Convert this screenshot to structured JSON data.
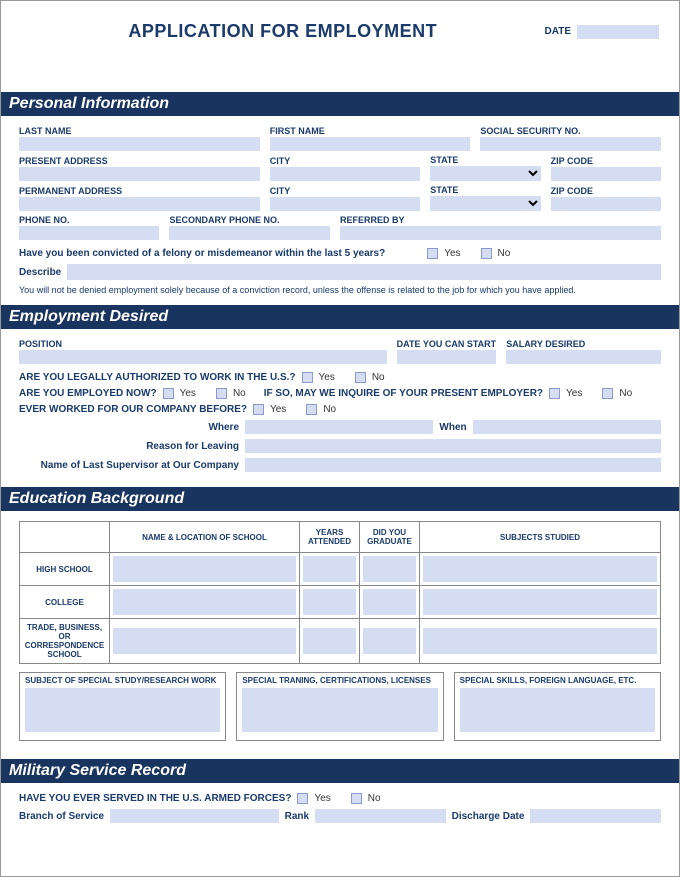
{
  "header": {
    "title": "APPLICATION FOR EMPLOYMENT",
    "date_label": "DATE"
  },
  "personal": {
    "section": "Personal Information",
    "last_name": "LAST NAME",
    "first_name": "FIRST NAME",
    "ssn": "SOCIAL SECURITY NO.",
    "present_address": "PRESENT ADDRESS",
    "city": "CITY",
    "state": "STATE",
    "zip": "ZIP CODE",
    "permanent_address": "PERMANENT ADDRESS",
    "phone": "PHONE NO.",
    "secondary_phone": "SECONDARY PHONE NO.",
    "referred_by": "REFERRED BY",
    "felony_q": "Have you been convicted of a felony or misdemeanor within the last 5 years?",
    "yes": "Yes",
    "no": "No",
    "describe": "Describe",
    "disclaimer": "You will not be denied employment solely because of a conviction record, unless the offense is related to the job for which you have applied."
  },
  "employment": {
    "section": "Employment Desired",
    "position": "POSITION",
    "date_start": "DATE YOU CAN START",
    "salary": "SALARY DESIRED",
    "authorized": "ARE YOU LEGALLY AUTHORIZED TO WORK IN THE U.S.?",
    "employed_now": "ARE YOU EMPLOYED NOW?",
    "inquire": "IF SO, MAY WE INQUIRE OF YOUR PRESENT EMPLOYER?",
    "ever_worked": "EVER WORKED FOR OUR COMPANY BEFORE?",
    "where": "Where",
    "when": "When",
    "reason_leaving": "Reason for Leaving",
    "last_supervisor": "Name of Last Supervisor at Our Company",
    "yes": "Yes",
    "no": "No"
  },
  "education": {
    "section": "Education Background",
    "col_school": "NAME & LOCATION OF SCHOOL",
    "col_years": "YEARS ATTENDED",
    "col_graduate": "DID YOU GRADUATE",
    "col_subjects": "SUBJECTS STUDIED",
    "row_highschool": "HIGH SCHOOL",
    "row_college": "COLLEGE",
    "row_trade": "TRADE, BUSINESS, OR CORRESPONDENCE SCHOOL",
    "special_study": "SUBJECT OF SPECIAL STUDY/RESEARCH WORK",
    "special_training": "SPECIAL TRANING, CERTIFICATIONS, LICENSES",
    "special_skills": "SPECIAL SKILLS, FOREIGN LANGUAGE, ETC."
  },
  "military": {
    "section": "Military Service Record",
    "served_q": "HAVE YOU EVER SERVED IN THE U.S. ARMED FORCES?",
    "yes": "Yes",
    "no": "No",
    "branch": "Branch of Service",
    "rank": "Rank",
    "discharge": "Discharge Date"
  }
}
